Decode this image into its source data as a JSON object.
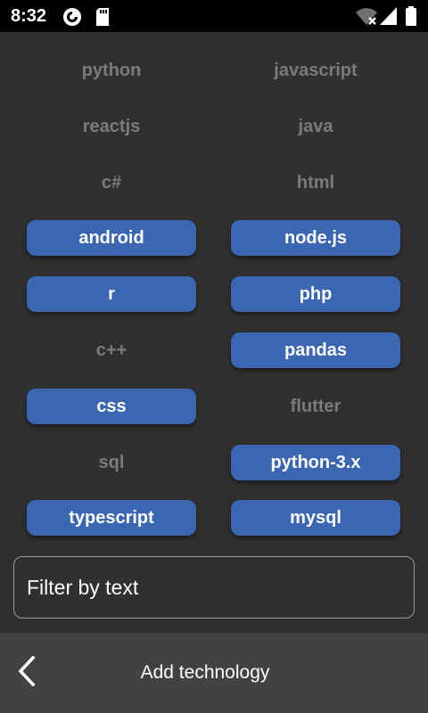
{
  "status_bar": {
    "time": "8:32",
    "left_icons": [
      "pocket-casts-icon",
      "sd-card-icon"
    ],
    "right_icons": [
      "wifi-off-icon",
      "signal-icon",
      "battery-icon"
    ]
  },
  "colors": {
    "background": "#303030",
    "chip_selected": "#3b66b2",
    "chip_unselected_text": "#7b7b7b",
    "bottom_bar": "#424242"
  },
  "technologies": [
    {
      "label": "python",
      "selected": false
    },
    {
      "label": "javascript",
      "selected": false
    },
    {
      "label": "reactjs",
      "selected": false
    },
    {
      "label": "java",
      "selected": false
    },
    {
      "label": "c#",
      "selected": false
    },
    {
      "label": "html",
      "selected": false
    },
    {
      "label": "android",
      "selected": true
    },
    {
      "label": "node.js",
      "selected": true
    },
    {
      "label": "r",
      "selected": true
    },
    {
      "label": "php",
      "selected": true
    },
    {
      "label": "c++",
      "selected": false
    },
    {
      "label": "pandas",
      "selected": true
    },
    {
      "label": "css",
      "selected": true
    },
    {
      "label": "flutter",
      "selected": false
    },
    {
      "label": "sql",
      "selected": false
    },
    {
      "label": "python-3.x",
      "selected": true
    },
    {
      "label": "typescript",
      "selected": true
    },
    {
      "label": "mysql",
      "selected": true
    }
  ],
  "filter": {
    "value": "",
    "placeholder": "Filter by text"
  },
  "bottom_bar": {
    "back_icon": "chevron-left-icon",
    "title": "Add technology"
  }
}
